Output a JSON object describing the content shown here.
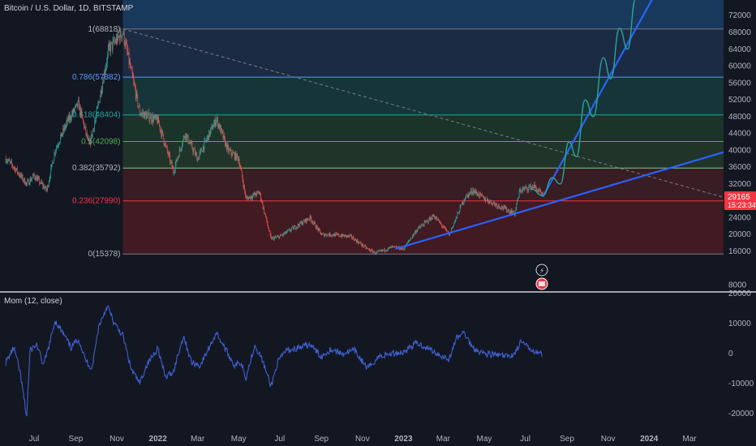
{
  "header": {
    "title": "Bitcoin / U.S. Dollar, 1D, BITSTAMP"
  },
  "price_badge": {
    "price": "29165",
    "countdown": "15:23:34",
    "color": "#f23645"
  },
  "indicator": {
    "title": "Mom (12, close)",
    "color": "#3f5fd0"
  },
  "chart_data": [
    {
      "type": "candlestick",
      "ylim": [
        7000,
        76000
      ],
      "y_ticks": [
        8000,
        16000,
        20000,
        24000,
        28000,
        32000,
        36000,
        40000,
        44000,
        48000,
        52000,
        56000,
        60000,
        64000,
        68000,
        72000
      ],
      "x_ticks": [
        "Jul",
        "Sep",
        "Nov",
        "2022",
        "Mar",
        "May",
        "Jul",
        "Sep",
        "Nov",
        "2023",
        "Mar",
        "May",
        "Jul",
        "Sep",
        "Nov",
        "2024",
        "Mar"
      ],
      "x_tick_dates": [
        "2021-07-01",
        "2021-09-01",
        "2021-11-01",
        "2022-01-01",
        "2022-03-01",
        "2022-05-01",
        "2022-07-01",
        "2022-09-01",
        "2022-11-01",
        "2023-01-01",
        "2023-03-01",
        "2023-05-01",
        "2023-07-01",
        "2023-09-01",
        "2023-11-01",
        "2024-01-01",
        "2024-03-01"
      ],
      "last_price": 29165,
      "up_color": "#26a69a",
      "down_color": "#ef5350",
      "price_path": [
        [
          "2021-05-20",
          38000
        ],
        [
          "2021-06-01",
          36000
        ],
        [
          "2021-06-20",
          32000
        ],
        [
          "2021-07-01",
          34000
        ],
        [
          "2021-07-20",
          30500
        ],
        [
          "2021-08-01",
          40000
        ],
        [
          "2021-08-20",
          47000
        ],
        [
          "2021-09-05",
          51000
        ],
        [
          "2021-09-21",
          41000
        ],
        [
          "2021-10-01",
          48000
        ],
        [
          "2021-10-20",
          64000
        ],
        [
          "2021-11-10",
          68000
        ],
        [
          "2021-12-05",
          49000
        ],
        [
          "2022-01-01",
          47000
        ],
        [
          "2022-01-24",
          35000
        ],
        [
          "2022-02-10",
          44000
        ],
        [
          "2022-03-01",
          38000
        ],
        [
          "2022-03-29",
          47500
        ],
        [
          "2022-04-15",
          40000
        ],
        [
          "2022-05-01",
          38000
        ],
        [
          "2022-05-12",
          28500
        ],
        [
          "2022-06-01",
          30000
        ],
        [
          "2022-06-18",
          19000
        ],
        [
          "2022-07-01",
          19500
        ],
        [
          "2022-08-15",
          24000
        ],
        [
          "2022-09-01",
          20000
        ],
        [
          "2022-09-15",
          20000
        ],
        [
          "2022-10-15",
          19500
        ],
        [
          "2022-11-09",
          16500
        ],
        [
          "2022-11-21",
          15600
        ],
        [
          "2022-12-15",
          17000
        ],
        [
          "2023-01-01",
          16600
        ],
        [
          "2023-01-20",
          21000
        ],
        [
          "2023-02-15",
          24500
        ],
        [
          "2023-03-10",
          20000
        ],
        [
          "2023-04-01",
          28500
        ],
        [
          "2023-04-14",
          30500
        ],
        [
          "2023-05-01",
          28500
        ],
        [
          "2023-06-15",
          25000
        ],
        [
          "2023-06-23",
          30500
        ],
        [
          "2023-07-14",
          31500
        ],
        [
          "2023-07-27",
          29165
        ]
      ],
      "fibonacci": [
        {
          "ratio": 1,
          "price": 68818,
          "label": "1(68818)",
          "fill": "#2a2e39",
          "line": "#787b86",
          "text": "#b2b5be"
        },
        {
          "ratio": 0.786,
          "price": 57382,
          "label": "0.786(57382)",
          "fill": "#1e2f4a",
          "line": "#5b9cf6",
          "text": "#5b9cf6"
        },
        {
          "ratio": 0.618,
          "price": 48404,
          "label": "0.618(48404)",
          "fill": "#163b3d",
          "line": "#26a69a",
          "text": "#26a69a"
        },
        {
          "ratio": 0.5,
          "price": 42098,
          "label": "0.5(42098)",
          "fill": "#1c3a2c",
          "line": "#4caf50",
          "text": "#4caf50"
        },
        {
          "ratio": 0.382,
          "price": 35792,
          "label": "0.382(35792)",
          "fill": "#233a2a",
          "line": "#81c784",
          "text": "#b2b5be"
        },
        {
          "ratio": 0.236,
          "price": 27990,
          "label": "0.236(27990)",
          "fill": "#3f1e24",
          "line": "#f23645",
          "text": "#f23645"
        },
        {
          "ratio": 0,
          "price": 15378,
          "label": "0(15378)",
          "fill": "#4a1b22",
          "line": "#787b86",
          "text": "#b2b5be"
        }
      ],
      "fib_extension_fill": "#1a3d63",
      "fib_range": {
        "start": "2021-11-10",
        "end": "2024-06-01"
      },
      "trendlines": [
        {
          "name": "dashed-diagonal",
          "from": [
            "2021-11-10",
            68818
          ],
          "to": [
            "2024-06-01",
            27000
          ],
          "style": "dashed",
          "color": "#787b86"
        },
        {
          "name": "lower-support",
          "from": [
            "2022-12-20",
            16600
          ],
          "to": [
            "2024-06-01",
            41500
          ],
          "style": "solid",
          "color": "#2962ff"
        },
        {
          "name": "steep-support",
          "from": [
            "2023-07-27",
            29000
          ],
          "to": [
            "2024-01-06",
            76000
          ],
          "style": "solid",
          "color": "#2962ff"
        }
      ],
      "projection": {
        "color": "#26a69a",
        "points": [
          [
            "2023-07-10",
            30800
          ],
          [
            "2023-07-27",
            29200
          ],
          [
            "2023-08-10",
            33500
          ],
          [
            "2023-08-22",
            32000
          ],
          [
            "2023-09-04",
            42000
          ],
          [
            "2023-09-15",
            38500
          ],
          [
            "2023-09-28",
            52000
          ],
          [
            "2023-10-10",
            48000
          ],
          [
            "2023-10-25",
            62000
          ],
          [
            "2023-11-05",
            57000
          ],
          [
            "2023-11-18",
            69000
          ],
          [
            "2023-11-30",
            64000
          ],
          [
            "2023-12-12",
            76000
          ]
        ]
      }
    },
    {
      "type": "line",
      "name": "Mom (12, close)",
      "ylim": [
        -24000,
        22000
      ],
      "y_ticks": [
        -20000,
        -10000,
        0,
        10000,
        20000
      ],
      "color": "#3f5fd0",
      "values_path": [
        [
          "2021-05-20",
          -3000
        ],
        [
          "2021-06-01",
          2000
        ],
        [
          "2021-06-10",
          -6000
        ],
        [
          "2021-06-20",
          -21000
        ],
        [
          "2021-06-25",
          1000
        ],
        [
          "2021-07-05",
          3000
        ],
        [
          "2021-07-15",
          -4000
        ],
        [
          "2021-07-25",
          4000
        ],
        [
          "2021-08-01",
          11000
        ],
        [
          "2021-08-15",
          6000
        ],
        [
          "2021-08-25",
          2000
        ],
        [
          "2021-09-05",
          5000
        ],
        [
          "2021-09-15",
          -2000
        ],
        [
          "2021-09-25",
          -5000
        ],
        [
          "2021-10-05",
          9000
        ],
        [
          "2021-10-18",
          16000
        ],
        [
          "2021-10-28",
          10000
        ],
        [
          "2021-11-10",
          6000
        ],
        [
          "2021-11-22",
          -5000
        ],
        [
          "2021-12-05",
          -10000
        ],
        [
          "2021-12-15",
          -4000
        ],
        [
          "2022-01-01",
          2000
        ],
        [
          "2022-01-12",
          -8000
        ],
        [
          "2022-01-24",
          -6000
        ],
        [
          "2022-02-08",
          6000
        ],
        [
          "2022-02-20",
          -3000
        ],
        [
          "2022-03-05",
          -4000
        ],
        [
          "2022-03-29",
          7000
        ],
        [
          "2022-04-10",
          2000
        ],
        [
          "2022-04-25",
          -4000
        ],
        [
          "2022-05-05",
          -3000
        ],
        [
          "2022-05-12",
          -8000
        ],
        [
          "2022-05-25",
          3000
        ],
        [
          "2022-06-05",
          -2000
        ],
        [
          "2022-06-18",
          -11000
        ],
        [
          "2022-06-28",
          -3000
        ],
        [
          "2022-07-10",
          1000
        ],
        [
          "2022-08-01",
          2000
        ],
        [
          "2022-08-15",
          3000
        ],
        [
          "2022-09-01",
          -1000
        ],
        [
          "2022-09-15",
          1500
        ],
        [
          "2022-10-01",
          0
        ],
        [
          "2022-10-20",
          1000
        ],
        [
          "2022-11-09",
          -5000
        ],
        [
          "2022-11-25",
          -1000
        ],
        [
          "2022-12-15",
          0
        ],
        [
          "2023-01-01",
          500
        ],
        [
          "2023-01-20",
          3500
        ],
        [
          "2023-02-05",
          2000
        ],
        [
          "2023-02-20",
          0
        ],
        [
          "2023-03-10",
          -2000
        ],
        [
          "2023-03-20",
          5000
        ],
        [
          "2023-04-01",
          7000
        ],
        [
          "2023-04-14",
          2000
        ],
        [
          "2023-05-01",
          0
        ],
        [
          "2023-05-20",
          -500
        ],
        [
          "2023-06-05",
          -1000
        ],
        [
          "2023-06-15",
          0
        ],
        [
          "2023-06-25",
          4000
        ],
        [
          "2023-07-05",
          2000
        ],
        [
          "2023-07-15",
          1000
        ],
        [
          "2023-07-27",
          -500
        ]
      ]
    }
  ]
}
